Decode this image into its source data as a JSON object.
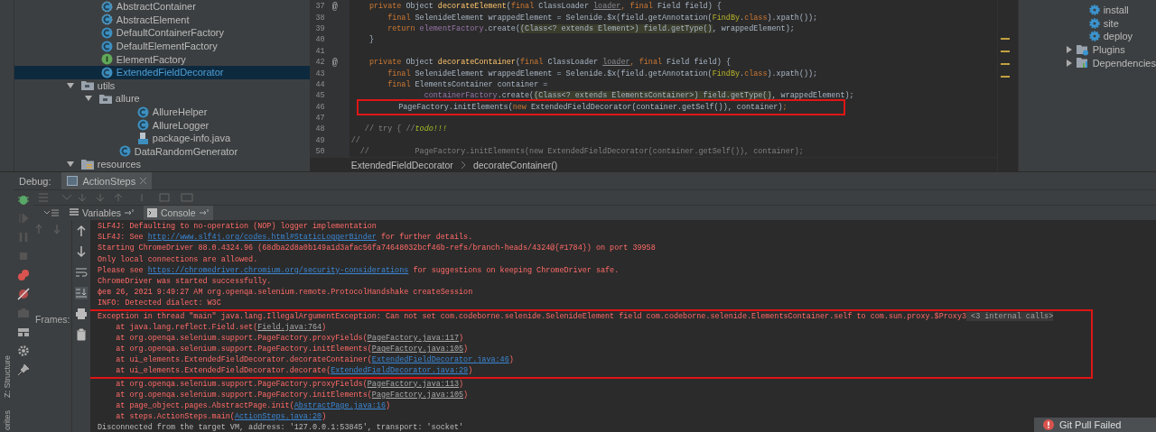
{
  "project_tree": {
    "items": [
      {
        "label": "AbstractContainer",
        "kind": "abstract",
        "selected": false
      },
      {
        "label": "AbstractElement",
        "kind": "abstract",
        "selected": false
      },
      {
        "label": "DefaultContainerFactory",
        "kind": "class",
        "selected": false
      },
      {
        "label": "DefaultElementFactory",
        "kind": "class",
        "selected": false
      },
      {
        "label": "ElementFactory",
        "kind": "interface",
        "selected": false
      },
      {
        "label": "ExtendedFieldDecorator",
        "kind": "class",
        "selected": true
      },
      {
        "label": "utils",
        "kind": "folder",
        "selected": false,
        "expanded": true,
        "children": [
          {
            "label": "allure",
            "kind": "folder",
            "selected": false,
            "expanded": true,
            "children": [
              {
                "label": "AllureHelper",
                "kind": "class",
                "selected": false
              },
              {
                "label": "AllureLogger",
                "kind": "class",
                "selected": false
              },
              {
                "label": "package-info.java",
                "kind": "file",
                "selected": false
              }
            ]
          },
          {
            "label": "DataRandomGenerator",
            "kind": "class",
            "selected": false
          }
        ]
      },
      {
        "label": "resources",
        "kind": "resfolder",
        "selected": false,
        "expanded": true
      }
    ]
  },
  "editor": {
    "lines": [
      {
        "number": "37",
        "marker": "@",
        "highlighted": false,
        "tokens": [
          {
            "t": "    private ",
            "kind": "kw"
          },
          {
            "t": "Object ",
            "kind": "plain"
          },
          {
            "t": "decorateElement",
            "kind": "fn"
          },
          {
            "t": "(",
            "kind": "plain"
          },
          {
            "t": "final ",
            "kind": "kw"
          },
          {
            "t": "ClassLoader ",
            "kind": "plain"
          },
          {
            "t": "loader",
            "kind": "unused"
          },
          {
            "t": ", final ",
            "kind": "kw"
          },
          {
            "t": "Field field) {",
            "kind": "plain"
          }
        ]
      },
      {
        "number": "38",
        "highlighted": false,
        "tokens": [
          {
            "t": "        final ",
            "kind": "kw"
          },
          {
            "t": "SelenideElement wrappedElement = Selenide.$x(field.getAnnotation(",
            "kind": "plain"
          },
          {
            "t": "FindBy",
            "kind": "annot"
          },
          {
            "t": ".",
            "kind": "plain"
          },
          {
            "t": "class",
            "kind": "kw"
          },
          {
            "t": ").xpath());",
            "kind": "plain"
          }
        ]
      },
      {
        "number": "39",
        "highlighted": false,
        "tokens": [
          {
            "t": "        return ",
            "kind": "kw"
          },
          {
            "t": "elementFactory",
            "kind": "field"
          },
          {
            "t": ".create(",
            "kind": "plain"
          },
          {
            "t": "(Class<? extends Element>) field.getType()",
            "kind": "hint"
          },
          {
            "t": ", wrappedElement);",
            "kind": "plain"
          }
        ]
      },
      {
        "number": "40",
        "highlighted": false,
        "tokens": [
          {
            "t": "    }",
            "kind": "plain"
          }
        ]
      },
      {
        "number": "41",
        "highlighted": false
      },
      {
        "number": "42",
        "marker": "@",
        "highlighted": false,
        "tokens": [
          {
            "t": "    private ",
            "kind": "kw"
          },
          {
            "t": "Object ",
            "kind": "plain"
          },
          {
            "t": "decorateContainer",
            "kind": "fn"
          },
          {
            "t": "(",
            "kind": "plain"
          },
          {
            "t": "final ",
            "kind": "kw"
          },
          {
            "t": "ClassLoader ",
            "kind": "plain"
          },
          {
            "t": "loader",
            "kind": "unused"
          },
          {
            "t": ", final ",
            "kind": "kw"
          },
          {
            "t": "Field field) {",
            "kind": "plain"
          }
        ]
      },
      {
        "number": "43",
        "highlighted": false,
        "tokens": [
          {
            "t": "        final ",
            "kind": "kw"
          },
          {
            "t": "SelenideElement wrappedElement = Selenide.$x(field.getAnnotation(",
            "kind": "plain"
          },
          {
            "t": "FindBy",
            "kind": "annot"
          },
          {
            "t": ".",
            "kind": "plain"
          },
          {
            "t": "class",
            "kind": "kw"
          },
          {
            "t": ").xpath());",
            "kind": "plain"
          }
        ]
      },
      {
        "number": "44",
        "highlighted": false,
        "tokens": [
          {
            "t": "        final ",
            "kind": "kw"
          },
          {
            "t": "ElementsContainer container =",
            "kind": "plain"
          }
        ]
      },
      {
        "number": "45",
        "highlighted": false,
        "tokens": [
          {
            "t": "                containerFactory",
            "kind": "field"
          },
          {
            "t": ".create(",
            "kind": "plain"
          },
          {
            "t": "(Class<? extends ElementsContainer>) field.getType()",
            "kind": "hint"
          },
          {
            "t": ", wrappedElement);",
            "kind": "plain"
          }
        ]
      },
      {
        "number": "46",
        "highlighted": true,
        "tokens": [
          {
            "t": "        PageFactory.initElements(",
            "kind": "plain"
          },
          {
            "t": "new ",
            "kind": "kw"
          },
          {
            "t": "ExtendedFieldDecorator(container.getSelf()), container)",
            "kind": "plain"
          },
          {
            "t": ";",
            "kind": "kw"
          }
        ]
      },
      {
        "number": "47",
        "highlighted": false
      },
      {
        "number": "48",
        "highlighted": false,
        "tokens": [
          {
            "t": "   // try { //",
            "kind": "comment"
          },
          {
            "t": "todo!!!",
            "kind": "todo"
          }
        ]
      },
      {
        "number": "49",
        "highlighted": false,
        "tokens": [
          {
            "t": "//",
            "kind": "comment"
          }
        ]
      },
      {
        "number": "50",
        "highlighted": false,
        "tokens": [
          {
            "t": "  //          PageFactory.initElements(new ExtendedFieldDecorator(container.getSelf()), container);",
            "kind": "comment"
          }
        ]
      }
    ],
    "breadcrumbs": [
      "ExtendedFieldDecorator",
      "decorateContainer()"
    ]
  },
  "maven_panel": {
    "items": [
      {
        "label": "install",
        "kind": "goal"
      },
      {
        "label": "site",
        "kind": "goal"
      },
      {
        "label": "deploy",
        "kind": "goal"
      },
      {
        "label": "Plugins",
        "kind": "plugins",
        "expanded": false
      },
      {
        "label": "Dependencies",
        "kind": "dependencies",
        "expanded": false
      }
    ]
  },
  "side_strip": [
    "Z: Structure",
    "orites"
  ],
  "debug": {
    "label": "Debug:",
    "session_tab": "ActionSteps",
    "tabs": [
      {
        "label": "Variables",
        "selected": false
      },
      {
        "label": "Console",
        "selected": true
      }
    ],
    "frames_label": "Frames:",
    "console": [
      {
        "highlighted": false,
        "parts": [
          {
            "t": "SLF4J: Defaulting to no-operation (NOP) logger implementation",
            "kind": "err"
          }
        ]
      },
      {
        "highlighted": false,
        "parts": [
          {
            "t": "SLF4J: See ",
            "kind": "err"
          },
          {
            "t": "http://www.slf4j.org/codes.html#StaticLoggerBinder",
            "kind": "link"
          },
          {
            "t": " for further details.",
            "kind": "err"
          }
        ]
      },
      {
        "highlighted": false,
        "parts": [
          {
            "t": "Starting ChromeDriver 88.0.4324.96 (68dba2d8a0b149a1d3afac56fa74648032bcf46b-refs/branch-heads/4324@{#1784}) on port 39958",
            "kind": "err"
          }
        ]
      },
      {
        "highlighted": false,
        "parts": [
          {
            "t": "Only local connections are allowed.",
            "kind": "err"
          }
        ]
      },
      {
        "highlighted": false,
        "parts": [
          {
            "t": "Please see ",
            "kind": "err"
          },
          {
            "t": "https://chromedriver.chromium.org/security-considerations",
            "kind": "link"
          },
          {
            "t": " for suggestions on keeping ChromeDriver safe.",
            "kind": "err"
          }
        ]
      },
      {
        "highlighted": false,
        "parts": [
          {
            "t": "ChromeDriver was started successfully.",
            "kind": "err"
          }
        ]
      },
      {
        "highlighted": false,
        "parts": [
          {
            "t": "фев 26, 2021 9:49:27 AM org.openqa.selenium.remote.ProtocolHandshake createSession",
            "kind": "err"
          }
        ]
      },
      {
        "highlighted": false,
        "parts": [
          {
            "t": "INFO: Detected dialect: W3C",
            "kind": "err"
          }
        ]
      },
      {
        "highlighted": true,
        "parts": [
          {
            "t": "Exception in thread \"main\" java.lang.IllegalArgumentException: Can not set com.codeborne.selenide.SelenideElement field com.codeborne.selenide.ElementsContainer.self to com.sun.proxy.$Proxy3",
            "kind": "err"
          },
          {
            "t": " <3 internal calls>",
            "kind": "internal"
          }
        ]
      },
      {
        "highlighted": true,
        "parts": [
          {
            "t": "    at java.lang.reflect.Field.set(",
            "kind": "err"
          },
          {
            "t": "Field.java:764",
            "kind": "lib"
          },
          {
            "t": ")",
            "kind": "err"
          }
        ]
      },
      {
        "highlighted": true,
        "parts": [
          {
            "t": "    at org.openqa.selenium.support.PageFactory.proxyFields(",
            "kind": "err"
          },
          {
            "t": "PageFactory.java:117",
            "kind": "lib"
          },
          {
            "t": ")",
            "kind": "err"
          }
        ]
      },
      {
        "highlighted": true,
        "parts": [
          {
            "t": "    at org.openqa.selenium.support.PageFactory.initElements(",
            "kind": "err"
          },
          {
            "t": "PageFactory.java:105",
            "kind": "lib"
          },
          {
            "t": ")",
            "kind": "err"
          }
        ]
      },
      {
        "highlighted": true,
        "parts": [
          {
            "t": "    at ui_elements.ExtendedFieldDecorator.decorateContainer(",
            "kind": "err"
          },
          {
            "t": "ExtendedFieldDecorator.java:46",
            "kind": "link"
          },
          {
            "t": ")",
            "kind": "err"
          }
        ]
      },
      {
        "highlighted": true,
        "parts": [
          {
            "t": "    at ui_elements.ExtendedFieldDecorator.decorate(",
            "kind": "err"
          },
          {
            "t": "ExtendedFieldDecorator.java:29",
            "kind": "link"
          },
          {
            "t": ")",
            "kind": "err"
          }
        ]
      },
      {
        "highlighted": false,
        "parts": [
          {
            "t": "    at org.openqa.selenium.support.PageFactory.proxyFields(",
            "kind": "err"
          },
          {
            "t": "PageFactory.java:113",
            "kind": "lib"
          },
          {
            "t": ")",
            "kind": "err"
          }
        ]
      },
      {
        "highlighted": false,
        "parts": [
          {
            "t": "    at org.openqa.selenium.support.PageFactory.initElements(",
            "kind": "err"
          },
          {
            "t": "PageFactory.java:105",
            "kind": "lib"
          },
          {
            "t": ")",
            "kind": "err"
          }
        ]
      },
      {
        "highlighted": false,
        "parts": [
          {
            "t": "    at page_object.pages.AbstractPage.init(",
            "kind": "err"
          },
          {
            "t": "AbstractPage.java:16",
            "kind": "link"
          },
          {
            "t": ")",
            "kind": "err"
          }
        ]
      },
      {
        "highlighted": false,
        "parts": [
          {
            "t": "    at steps.ActionSteps.main(",
            "kind": "err"
          },
          {
            "t": "ActionSteps.java:20",
            "kind": "link"
          },
          {
            "t": ")",
            "kind": "err"
          }
        ]
      },
      {
        "highlighted": false,
        "parts": [
          {
            "t": "Disconnected from the target VM, address: '127.0.0.1:53845', transport: 'socket'",
            "kind": "sys"
          }
        ]
      }
    ]
  },
  "notification": {
    "title": "Git Pull Failed"
  }
}
